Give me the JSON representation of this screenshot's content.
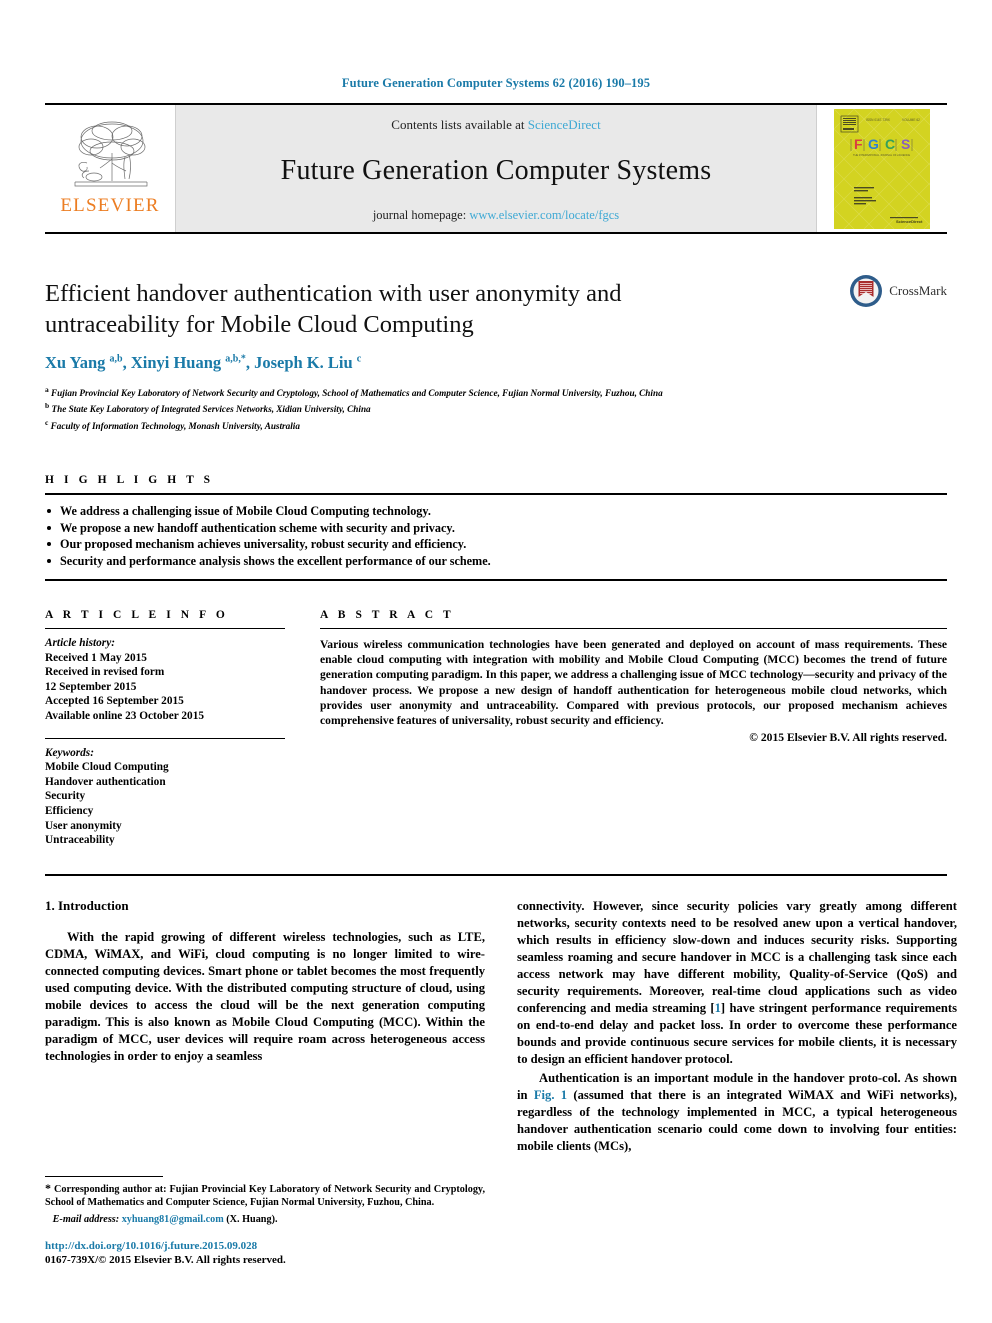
{
  "running_head": "Future Generation Computer Systems 62 (2016) 190–195",
  "masthead": {
    "contents_prefix": "Contents lists available at ",
    "sciencedirect": "ScienceDirect",
    "journal_title": "Future Generation Computer Systems",
    "homepage_prefix": "journal homepage: ",
    "homepage_url": "www.elsevier.com/locate/fgcs",
    "publisher_wordmark": "ELSEVIER",
    "cover_logo_letters": [
      "F",
      "G",
      "C",
      "S"
    ],
    "accent_link_color": "#3fa9d4",
    "elsevier_orange": "#ec7d22",
    "cover_background": "#d3d321"
  },
  "article": {
    "title": "Efficient handover authentication with user anonymity and untraceability for Mobile Cloud Computing",
    "authors_html": "Xu Yang <sup>a,b</sup>, Xinyi Huang <sup>a,b,*</sup>, Joseph K. Liu <sup>c</sup>",
    "crossmark_label": "CrossMark",
    "affiliations": [
      {
        "marker": "a",
        "text": "Fujian Provincial Key Laboratory of Network Security and Cryptology, School of Mathematics and Computer Science, Fujian Normal University, Fuzhou, China"
      },
      {
        "marker": "b",
        "text": "The State Key Laboratory of Integrated Services Networks, Xidian University, China"
      },
      {
        "marker": "c",
        "text": "Faculty of Information Technology, Monash University, Australia"
      }
    ]
  },
  "highlights": {
    "heading": "H I G H L I G H T S",
    "items": [
      "We address a challenging issue of Mobile Cloud Computing technology.",
      "We propose a new handoff authentication scheme with security and privacy.",
      "Our proposed mechanism achieves universality, robust security and efficiency.",
      "Security and performance analysis shows the excellent performance of our scheme."
    ]
  },
  "article_info": {
    "heading": "A R T I C L E   I N F O",
    "history_label": "Article history:",
    "history": [
      "Received 1 May 2015",
      "Received in revised form",
      "12 September 2015",
      "Accepted 16 September 2015",
      "Available online 23 October 2015"
    ],
    "keywords_label": "Keywords:",
    "keywords": [
      "Mobile Cloud Computing",
      "Handover authentication",
      "Security",
      "Efficiency",
      "User anonymity",
      "Untraceability"
    ]
  },
  "abstract": {
    "heading": "A B S T R A C T",
    "body": "Various wireless communication technologies have been generated and deployed on account of mass requirements. These enable cloud computing with integration with mobility and Mobile Cloud Computing (MCC) becomes the trend of future generation computing paradigm. In this paper, we address a challenging issue of MCC technology—security and privacy of the handover process. We propose a new design of handoff authentication for heterogeneous mobile cloud networks, which provides user anonymity and untraceability. Compared with previous protocols, our proposed mechanism achieves comprehensive features of universality, robust security and efficiency.",
    "copyright": "© 2015 Elsevier B.V. All rights reserved."
  },
  "body": {
    "section_number": "1.",
    "section_title": "Introduction",
    "left_paragraph": "With the rapid growing of different wireless technologies, such as LTE, CDMA, WiMAX, and WiFi, cloud computing is no longer limited to wire-connected computing devices. Smart phone or tablet becomes the most frequently used computing device. With the distributed computing structure of cloud, using mobile devices to access the cloud will be the next generation computing paradigm. This is also known as Mobile Cloud Computing (MCC). Within the paradigm of MCC, user devices will require roam across heterogeneous access technologies in order to enjoy a seamless",
    "right_paragraph_1a": "connectivity. However, since security policies vary greatly among different networks, security contexts need to be resolved anew upon a vertical handover, which results in efficiency slow-down and induces security risks. Supporting seamless roaming and secure handover in MCC is a challenging task since each access network may have different mobility, Quality-of-Service (QoS) and security requirements. Moreover, real-time cloud applications such as video conferencing and media streaming [",
    "right_ref_1": "1",
    "right_paragraph_1b": "] have stringent performance requirements on end-to-end delay and packet loss. In order to overcome these performance bounds and provide continuous secure services for mobile clients, it is necessary to design an efficient handover protocol.",
    "right_paragraph_2a": "Authentication is an important module in the handover proto-col. As shown in ",
    "right_fig_ref": "Fig. 1",
    "right_paragraph_2b": " (assumed that there is an integrated WiMAX and WiFi networks), regardless of the technology implemented in MCC, a typical heterogeneous handover authentication scenario could come down to involving four entities: mobile clients (MCs),"
  },
  "footnote": {
    "corresponding": "Corresponding author at: Fujian Provincial Key Laboratory of Network Security and Cryptology, School of Mathematics and Computer Science, Fujian Normal University, Fuzhou, China.",
    "email_label": "E-mail address:",
    "email": "xyhuang81@gmail.com",
    "email_owner": "(X. Huang).",
    "doi": "http://dx.doi.org/10.1016/j.future.2015.09.028",
    "issn_line": "0167-739X/© 2015 Elsevier B.V. All rights reserved."
  }
}
